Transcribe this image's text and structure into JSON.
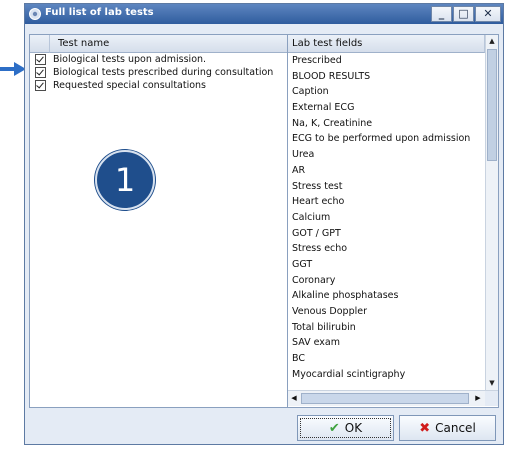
{
  "window": {
    "title": "Full list of lab tests",
    "minimize": "_",
    "maximize": "□",
    "close": "✕"
  },
  "left_pane": {
    "header": "Test name",
    "items": [
      {
        "label": "Biological tests upon admission.",
        "checked": true
      },
      {
        "label": "Biological tests prescribed during consultation",
        "checked": true
      },
      {
        "label": "Requested special consultations",
        "checked": true
      }
    ]
  },
  "badge": {
    "number": "1"
  },
  "right_pane": {
    "header": "Lab test fields",
    "items": [
      "Prescribed",
      "BLOOD RESULTS",
      "Caption",
      "External ECG",
      "Na, K, Creatinine",
      "ECG to be performed upon admission",
      "Urea",
      "AR",
      "Stress test",
      "Heart echo",
      "Calcium",
      "GOT / GPT",
      "Stress echo",
      "GGT",
      "Coronary",
      "Alkaline phosphatases",
      "Venous Doppler",
      "Total bilirubin",
      "SAV exam",
      "BC",
      "Myocardial scintigraphy"
    ]
  },
  "buttons": {
    "ok": "OK",
    "cancel": "Cancel",
    "ok_icon": "check-icon",
    "cancel_icon": "x-icon"
  },
  "colors": {
    "title_bar": "#2f5c9e",
    "badge": "#1f4e8c",
    "arrow": "#2d6ec6",
    "ok_check": "#3fa33f",
    "cancel_x": "#d01c1c"
  }
}
